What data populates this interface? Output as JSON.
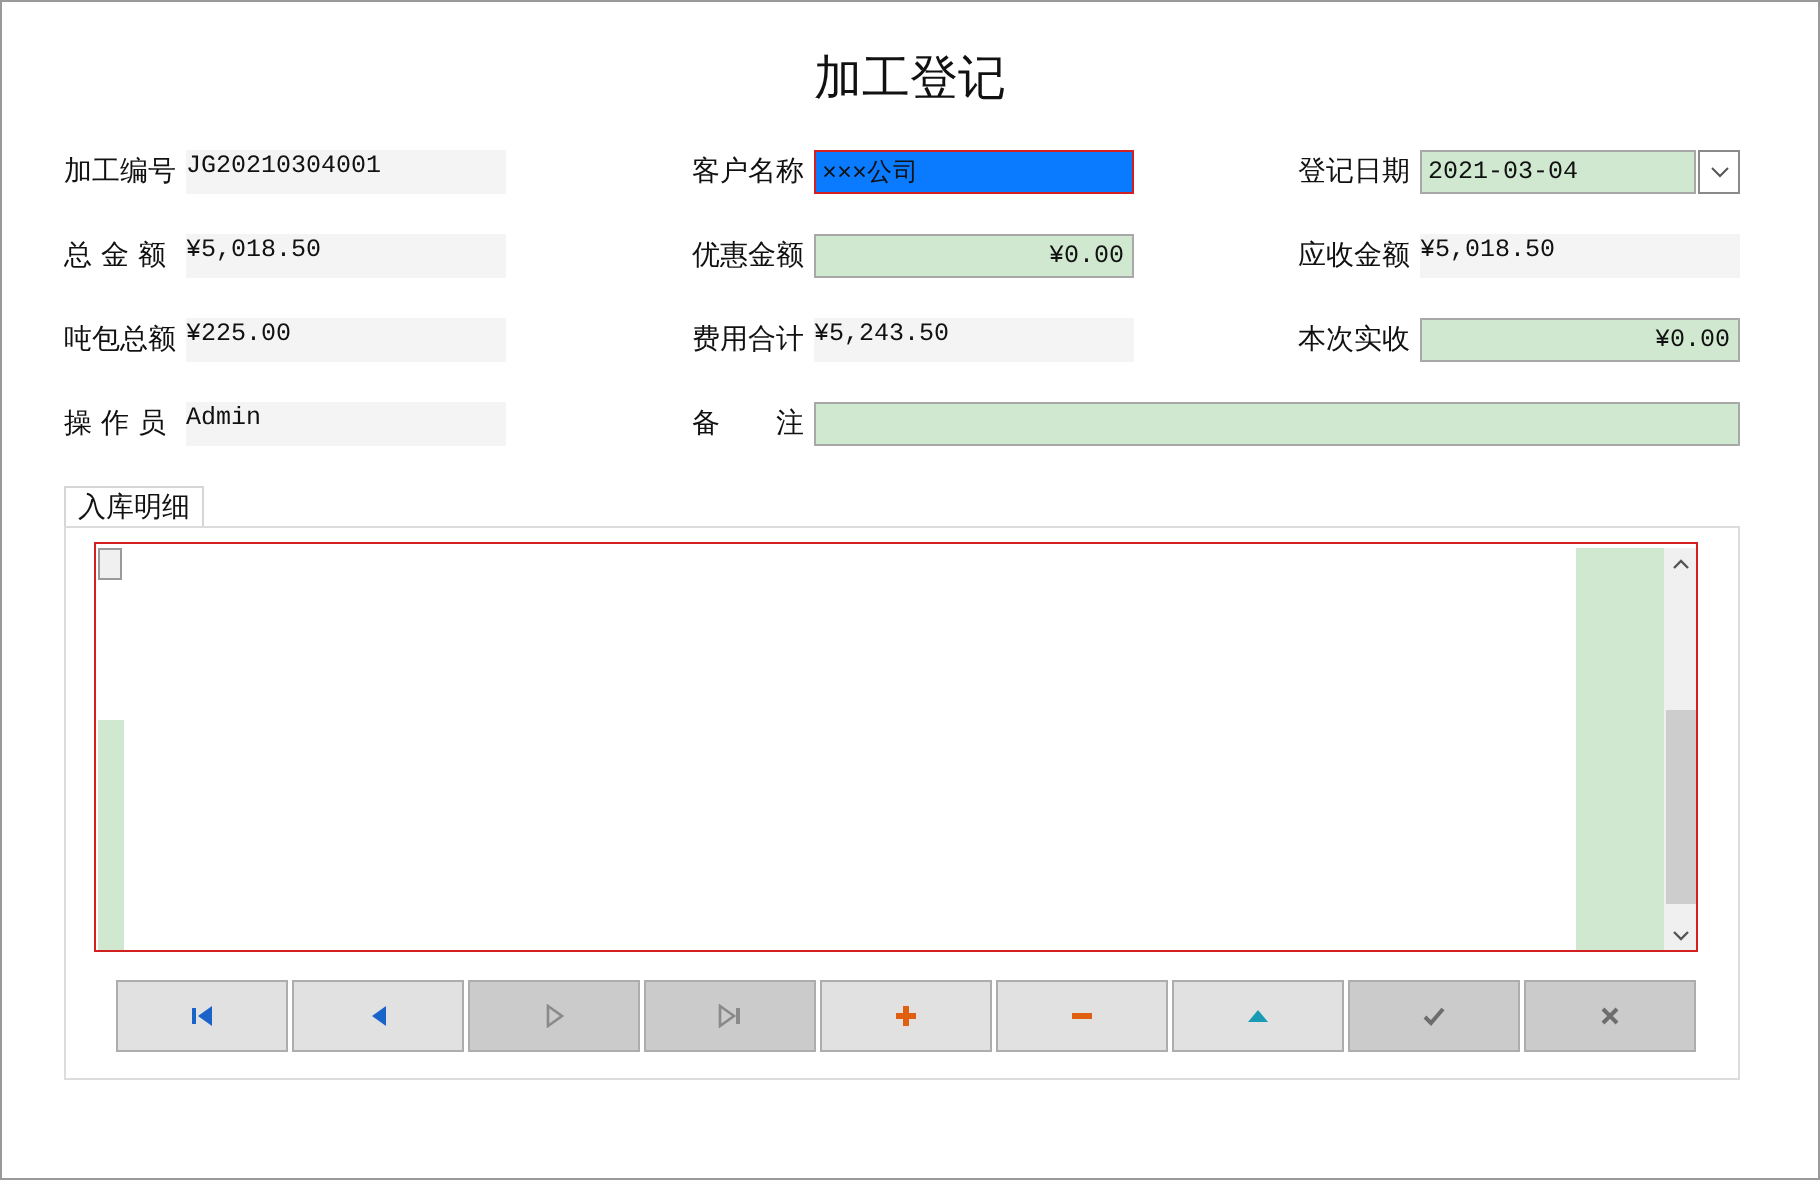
{
  "title": "加工登记",
  "rows": [
    [
      {
        "label": "加工编号",
        "value": "JG20210304001",
        "kind": "display"
      },
      {
        "label": "客户名称",
        "value": "×××公司",
        "kind": "text",
        "focused": true
      },
      {
        "label": "登记日期",
        "value": "2021-03-04",
        "kind": "date"
      }
    ],
    [
      {
        "label": "总 金 额",
        "value": "¥5,018.50",
        "kind": "display"
      },
      {
        "label": "优惠金额",
        "value": "¥0.00",
        "kind": "amount",
        "focused": false
      },
      {
        "label": "应收金额",
        "value": "¥5,018.50",
        "kind": "display"
      }
    ],
    [
      {
        "label": "吨包总额",
        "value": "¥225.00",
        "kind": "display"
      },
      {
        "label": "费用合计",
        "value": "¥5,243.50",
        "kind": "display"
      },
      {
        "label": "本次实收",
        "value": "¥0.00",
        "kind": "amount",
        "focused": false
      }
    ],
    [
      {
        "label": "操 作 员",
        "value": "Admin",
        "kind": "display"
      },
      {
        "label": "备　　注",
        "kind": "text",
        "focused": false,
        "wide": true
      }
    ]
  ],
  "tabs": [
    {
      "label": "入库明细",
      "selected": true
    }
  ],
  "nav_buttons": [
    {
      "kind": "first",
      "enabled": true
    },
    {
      "kind": "prior",
      "enabled": true
    },
    {
      "kind": "next",
      "enabled": false
    },
    {
      "kind": "last",
      "enabled": false
    },
    {
      "kind": "insert",
      "enabled": true
    },
    {
      "kind": "delete",
      "enabled": true
    },
    {
      "kind": "edit",
      "enabled": true
    },
    {
      "kind": "post",
      "enabled": false
    },
    {
      "kind": "cancel",
      "enabled": false
    }
  ]
}
